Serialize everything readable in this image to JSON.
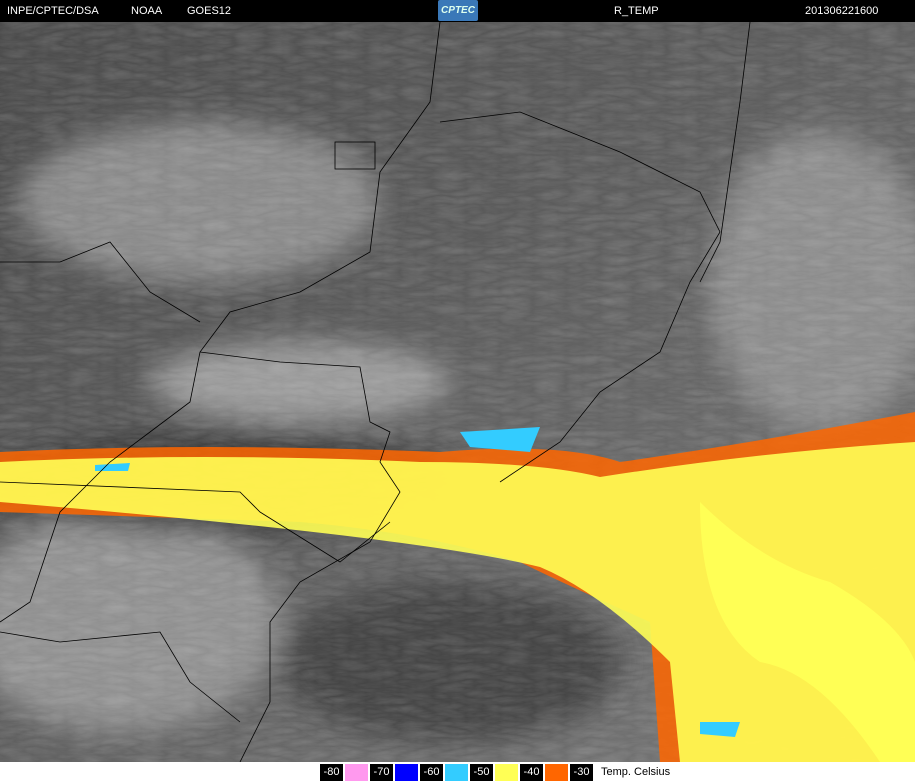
{
  "header": {
    "source": "INPE/CPTEC/DSA",
    "agency": "NOAA",
    "satellite": "GOES12",
    "logo": "CPTEC",
    "product": "R_TEMP",
    "datetime": "201306221600"
  },
  "legend": {
    "items": [
      {
        "label": "-80",
        "color": "#ff99ee"
      },
      {
        "label": "-70",
        "color": "#0000ff"
      },
      {
        "label": "-60",
        "color": "#33ccff"
      },
      {
        "label": "-50",
        "color": "#ffff55"
      },
      {
        "label": "-40",
        "color": "#ff6600"
      },
      {
        "label": "-30",
        "color": null
      }
    ],
    "unit": "Temp. Celsius"
  }
}
